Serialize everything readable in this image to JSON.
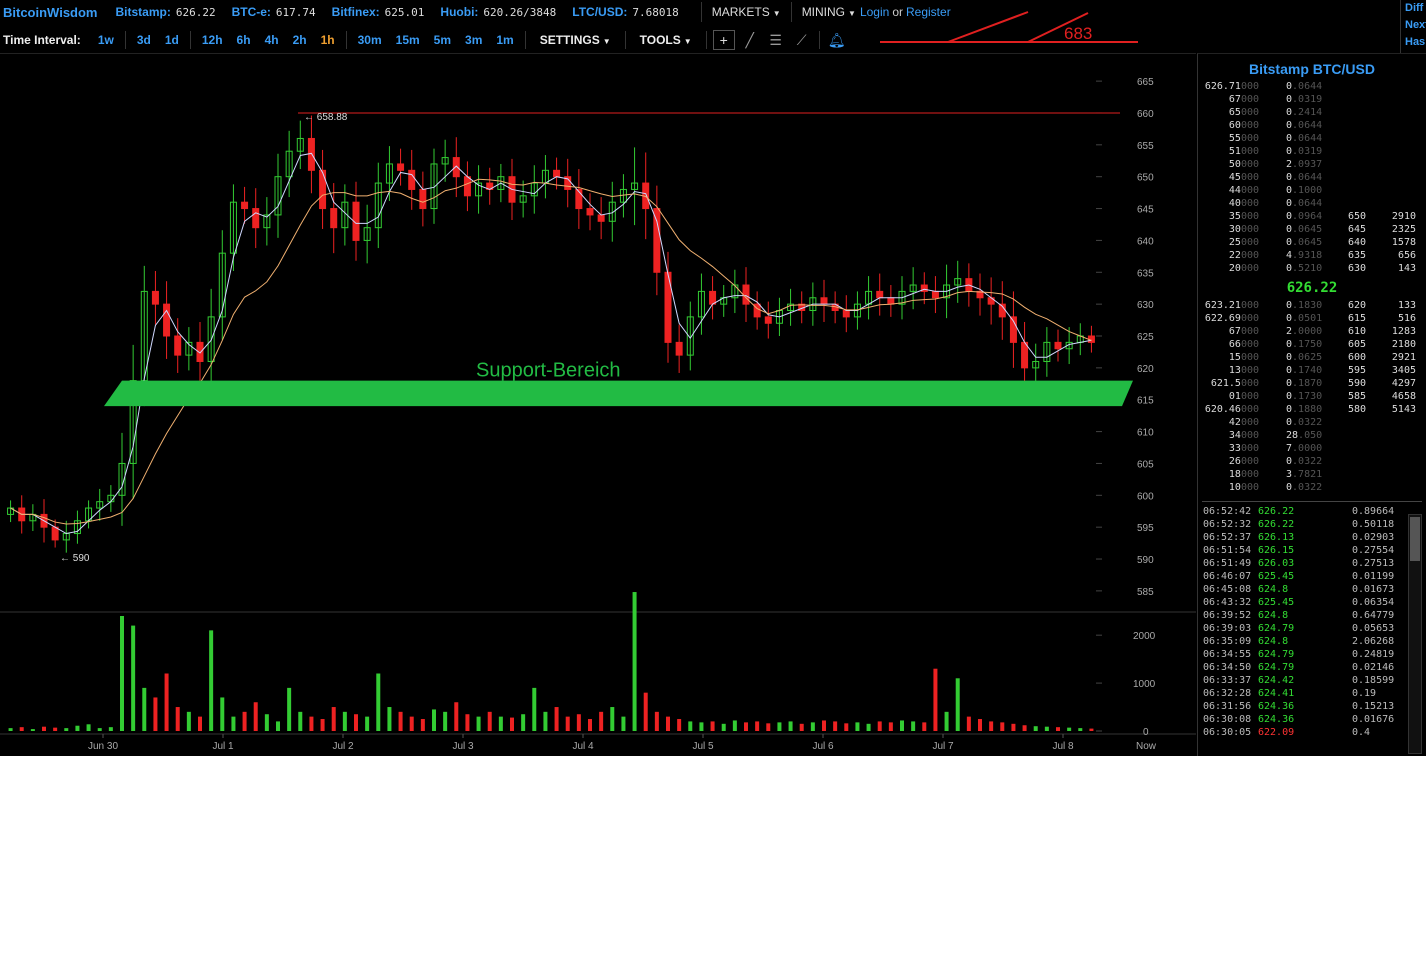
{
  "brand": "BitcoinWisdom",
  "markets": [
    {
      "name": "Bitstamp:",
      "value": "626.22"
    },
    {
      "name": "BTC-e:",
      "value": "617.74"
    },
    {
      "name": "Bitfinex:",
      "value": "625.01"
    },
    {
      "name": "Huobi:",
      "value": "620.26/3848"
    },
    {
      "name": "LTC/USD:",
      "value": "7.68018"
    }
  ],
  "menus": {
    "markets": "MARKETS",
    "mining": "MINING"
  },
  "auth": {
    "login": "Login",
    "or": "or",
    "register": "Register"
  },
  "right_edge": [
    "Diff",
    "Next",
    "Has"
  ],
  "annotation_top": "683",
  "toolbar": {
    "label": "Time Interval:",
    "intervals": [
      "1w",
      "3d",
      "1d",
      "12h",
      "6h",
      "4h",
      "2h",
      "1h",
      "30m",
      "15m",
      "5m",
      "3m",
      "1m"
    ],
    "active": "1h",
    "settings": "SETTINGS",
    "tools": "TOOLS"
  },
  "colors": {
    "up": "#33cc33",
    "down": "#ee2222",
    "accent": "#3a9cf5",
    "active": "#f0a030",
    "support": "#22bb44"
  },
  "chart_data": {
    "type": "candlestick",
    "market": "Bitstamp BTC/USD",
    "interval": "1h",
    "price_axis": [
      665,
      660,
      655,
      650,
      645,
      640,
      635,
      630,
      625,
      620,
      615,
      610,
      605,
      600,
      595,
      590,
      585
    ],
    "price_range": [
      582,
      668
    ],
    "volume_axis": [
      2000,
      1000,
      0
    ],
    "volume_range": [
      0,
      2400
    ],
    "x_labels": [
      "Jun 30",
      "Jul 1",
      "Jul 2",
      "Jul 3",
      "Jul 4",
      "Jul 5",
      "Jul 6",
      "Jul 7",
      "Jul 8",
      "Now"
    ],
    "high_label": "658.88",
    "low_label": "590",
    "resistance_line": 660,
    "support_zone": {
      "label": "Support-Bereich",
      "from": 614,
      "to": 618
    },
    "closes": [
      598,
      596,
      597,
      595,
      593,
      594,
      596,
      598,
      599,
      600,
      605,
      618,
      632,
      630,
      625,
      622,
      624,
      621,
      628,
      638,
      646,
      645,
      642,
      644,
      650,
      654,
      656,
      651,
      645,
      642,
      646,
      640,
      642,
      649,
      652,
      651,
      648,
      645,
      652,
      653,
      650,
      647,
      649,
      648,
      650,
      646,
      647,
      649,
      651,
      650,
      648,
      645,
      644,
      643,
      646,
      648,
      649,
      645,
      635,
      624,
      622,
      628,
      632,
      630,
      631,
      633,
      630,
      628,
      627,
      629,
      630,
      629,
      631,
      630,
      629,
      628,
      630,
      632,
      631,
      630,
      632,
      633,
      632,
      631,
      633,
      634,
      632,
      631,
      630,
      628,
      624,
      620,
      621,
      624,
      623,
      624,
      625,
      624
    ],
    "volumes": [
      60,
      80,
      40,
      90,
      70,
      60,
      110,
      140,
      60,
      80,
      2400,
      2200,
      900,
      700,
      1200,
      500,
      400,
      300,
      2100,
      700,
      300,
      400,
      600,
      350,
      200,
      900,
      400,
      300,
      250,
      500,
      400,
      350,
      300,
      1200,
      500,
      400,
      300,
      250,
      450,
      400,
      600,
      350,
      300,
      400,
      300,
      280,
      350,
      900,
      400,
      500,
      300,
      350,
      250,
      400,
      500,
      300,
      2900,
      800,
      400,
      300,
      250,
      200,
      180,
      200,
      150,
      220,
      180,
      200,
      160,
      180,
      200,
      150,
      180,
      220,
      200,
      160,
      180,
      150,
      200,
      180,
      220,
      200,
      180,
      1300,
      400,
      1100,
      300,
      250,
      200,
      180,
      150,
      120,
      100,
      90,
      80,
      70,
      60,
      50
    ]
  },
  "orderbook": {
    "title": "Bitstamp BTC/USD",
    "asks": [
      {
        "price_bright": "626.71",
        "price_dim": "000",
        "amt_bright": "0",
        "amt_dim": ".0644",
        "lvl": "",
        "sum": ""
      },
      {
        "price_bright": "67",
        "price_dim": "000",
        "amt_bright": "0",
        "amt_dim": ".0319",
        "lvl": "",
        "sum": ""
      },
      {
        "price_bright": "65",
        "price_dim": "000",
        "amt_bright": "0",
        "amt_dim": ".2414",
        "lvl": "",
        "sum": ""
      },
      {
        "price_bright": "60",
        "price_dim": "000",
        "amt_bright": "0",
        "amt_dim": ".0644",
        "lvl": "",
        "sum": ""
      },
      {
        "price_bright": "55",
        "price_dim": "000",
        "amt_bright": "0",
        "amt_dim": ".0644",
        "lvl": "",
        "sum": ""
      },
      {
        "price_bright": "51",
        "price_dim": "000",
        "amt_bright": "0",
        "amt_dim": ".0319",
        "lvl": "",
        "sum": ""
      },
      {
        "price_bright": "50",
        "price_dim": "000",
        "amt_bright": "2",
        "amt_dim": ".0937",
        "lvl": "",
        "sum": ""
      },
      {
        "price_bright": "45",
        "price_dim": "000",
        "amt_bright": "0",
        "amt_dim": ".0644",
        "lvl": "",
        "sum": ""
      },
      {
        "price_bright": "44",
        "price_dim": "000",
        "amt_bright": "0",
        "amt_dim": ".1000",
        "lvl": "",
        "sum": ""
      },
      {
        "price_bright": "40",
        "price_dim": "000",
        "amt_bright": "0",
        "amt_dim": ".0644",
        "lvl": "",
        "sum": ""
      },
      {
        "price_bright": "35",
        "price_dim": "000",
        "amt_bright": "0",
        "amt_dim": ".0964",
        "lvl": "650",
        "sum": "2910"
      },
      {
        "price_bright": "30",
        "price_dim": "000",
        "amt_bright": "0",
        "amt_dim": ".0645",
        "lvl": "645",
        "sum": "2325"
      },
      {
        "price_bright": "25",
        "price_dim": "000",
        "amt_bright": "0",
        "amt_dim": ".0645",
        "lvl": "640",
        "sum": "1578"
      },
      {
        "price_bright": "22",
        "price_dim": "000",
        "amt_bright": "4",
        "amt_dim": ".9318",
        "lvl": "635",
        "sum": "656"
      },
      {
        "price_bright": "20",
        "price_dim": "000",
        "amt_bright": "0",
        "amt_dim": ".5210",
        "lvl": "630",
        "sum": "143"
      }
    ],
    "last": "626.22",
    "bids": [
      {
        "price_bright": "623.21",
        "price_dim": "000",
        "amt_bright": "0",
        "amt_dim": ".1830",
        "lvl": "620",
        "sum": "133"
      },
      {
        "price_bright": "622.69",
        "price_dim": "000",
        "amt_bright": "0",
        "amt_dim": ".0501",
        "lvl": "615",
        "sum": "516"
      },
      {
        "price_bright": "67",
        "price_dim": "000",
        "amt_bright": "2",
        "amt_dim": ".0000",
        "lvl": "610",
        "sum": "1283"
      },
      {
        "price_bright": "66",
        "price_dim": "000",
        "amt_bright": "0",
        "amt_dim": ".1750",
        "lvl": "605",
        "sum": "2180"
      },
      {
        "price_bright": "15",
        "price_dim": "000",
        "amt_bright": "0",
        "amt_dim": ".0625",
        "lvl": "600",
        "sum": "2921"
      },
      {
        "price_bright": "13",
        "price_dim": "000",
        "amt_bright": "0",
        "amt_dim": ".1740",
        "lvl": "595",
        "sum": "3405"
      },
      {
        "price_bright": "621.5",
        "price_dim": "000",
        "amt_bright": "0",
        "amt_dim": ".1870",
        "lvl": "590",
        "sum": "4297"
      },
      {
        "price_bright": "01",
        "price_dim": "000",
        "amt_bright": "0",
        "amt_dim": ".1730",
        "lvl": "585",
        "sum": "4658"
      },
      {
        "price_bright": "620.46",
        "price_dim": "000",
        "amt_bright": "0",
        "amt_dim": ".1880",
        "lvl": "580",
        "sum": "5143"
      },
      {
        "price_bright": "42",
        "price_dim": "000",
        "amt_bright": "0",
        "amt_dim": ".0322",
        "lvl": "",
        "sum": ""
      },
      {
        "price_bright": "34",
        "price_dim": "000",
        "amt_bright": "28",
        "amt_dim": ".050",
        "lvl": "",
        "sum": ""
      },
      {
        "price_bright": "33",
        "price_dim": "000",
        "amt_bright": "7",
        "amt_dim": ".0000",
        "lvl": "",
        "sum": ""
      },
      {
        "price_bright": "26",
        "price_dim": "000",
        "amt_bright": "0",
        "amt_dim": ".0322",
        "lvl": "",
        "sum": ""
      },
      {
        "price_bright": "18",
        "price_dim": "000",
        "amt_bright": "3",
        "amt_dim": ".7821",
        "lvl": "",
        "sum": ""
      },
      {
        "price_bright": "10",
        "price_dim": "000",
        "amt_bright": "0",
        "amt_dim": ".0322",
        "lvl": "",
        "sum": ""
      }
    ]
  },
  "trades": [
    {
      "time": "06:52:42",
      "price": "626.22",
      "amount": "0.89664",
      "dir": "up"
    },
    {
      "time": "06:52:32",
      "price": "626.22",
      "amount": "0.50118",
      "dir": "up"
    },
    {
      "time": "06:52:37",
      "price": "626.13",
      "amount": "0.02903",
      "dir": "up"
    },
    {
      "time": "06:51:54",
      "price": "626.15",
      "amount": "0.27554",
      "dir": "up"
    },
    {
      "time": "06:51:49",
      "price": "626.03",
      "amount": "0.27513",
      "dir": "up"
    },
    {
      "time": "06:46:07",
      "price": "625.45",
      "amount": "0.01199",
      "dir": "up"
    },
    {
      "time": "06:45:08",
      "price": "624.8",
      "amount": "0.01673",
      "dir": "up"
    },
    {
      "time": "06:43:32",
      "price": "625.45",
      "amount": "0.06354",
      "dir": "up"
    },
    {
      "time": "06:39:52",
      "price": "624.8",
      "amount": "0.64779",
      "dir": "up"
    },
    {
      "time": "06:39:03",
      "price": "624.79",
      "amount": "0.05653",
      "dir": "up"
    },
    {
      "time": "06:35:09",
      "price": "624.8",
      "amount": "2.06268",
      "dir": "up"
    },
    {
      "time": "06:34:55",
      "price": "624.79",
      "amount": "0.24819",
      "dir": "up"
    },
    {
      "time": "06:34:50",
      "price": "624.79",
      "amount": "0.02146",
      "dir": "up"
    },
    {
      "time": "06:33:37",
      "price": "624.42",
      "amount": "0.18599",
      "dir": "up"
    },
    {
      "time": "06:32:28",
      "price": "624.41",
      "amount": "0.19",
      "dir": "up"
    },
    {
      "time": "06:31:56",
      "price": "624.36",
      "amount": "0.15213",
      "dir": "up"
    },
    {
      "time": "06:30:08",
      "price": "624.36",
      "amount": "0.01676",
      "dir": "up"
    },
    {
      "time": "06:30:05",
      "price": "622.09",
      "amount": "0.4",
      "dir": "down"
    }
  ]
}
